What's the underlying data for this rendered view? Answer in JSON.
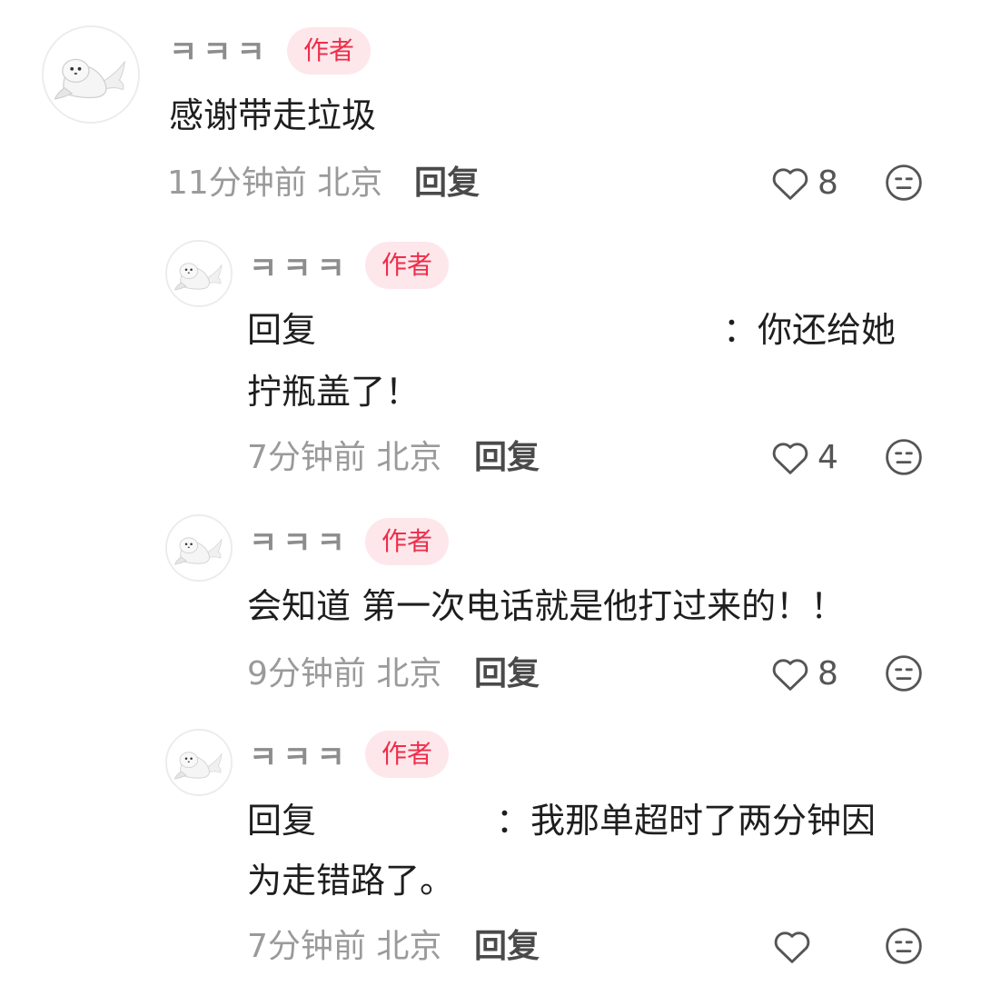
{
  "comments": [
    {
      "username": "ㅋㅋㅋ",
      "badge": "作者",
      "text": "感谢带走垃圾",
      "time_location": "11分钟前 北京",
      "reply_label": "回复",
      "like_count": "8"
    },
    {
      "username": "ㅋㅋㅋ",
      "badge": "作者",
      "reply_prefix": "回复",
      "reply_tail": "：你还给她",
      "text_line2": "拧瓶盖了！",
      "time_location": "7分钟前 北京",
      "reply_label": "回复",
      "like_count": "4"
    },
    {
      "username": "ㅋㅋㅋ",
      "badge": "作者",
      "text": "会知道 第一次电话就是他打过来的！！",
      "time_location": "9分钟前 北京",
      "reply_label": "回复",
      "like_count": "8"
    },
    {
      "username": "ㅋㅋㅋ",
      "badge": "作者",
      "reply_prefix": "回复",
      "reply_tail": "：我那单超时了两分钟因",
      "text_line2": "为走错路了。",
      "time_location": "7分钟前 北京",
      "reply_label": "回复",
      "like_count": ""
    }
  ],
  "icons": {
    "like": "heart-outline-icon",
    "emoji": "neutral-face-icon",
    "avatar": "seal-avatar"
  },
  "colors": {
    "badge_bg": "#fde7ea",
    "badge_text": "#ee2e4b",
    "meta_text": "#9a9a9a",
    "username_text": "#8d8d8d"
  }
}
